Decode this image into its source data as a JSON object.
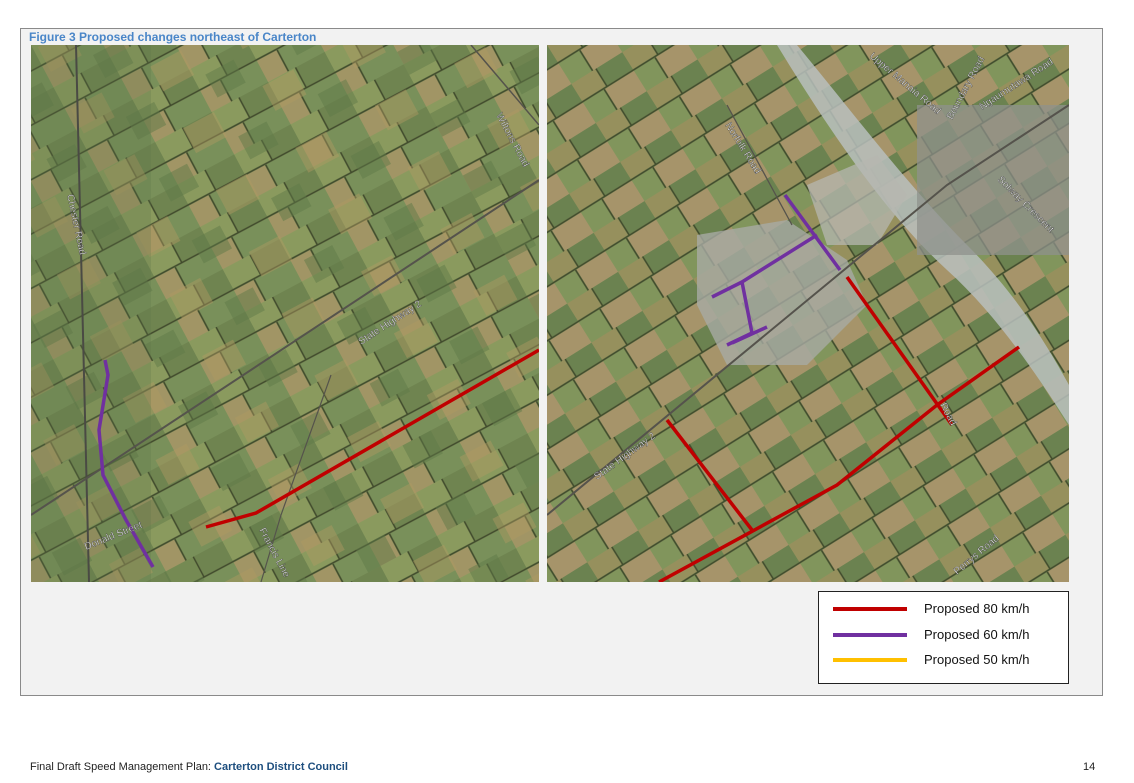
{
  "figure_title": "Figure 3 Proposed changes northeast of Carterton",
  "left_map": {
    "road_labels": [
      "Chester Road",
      "Wiltons Road",
      "State Highway 2",
      "Donald Street",
      "Francis Line"
    ]
  },
  "right_map": {
    "road_labels": [
      "Norfolk Road",
      "Upper Manaia Road",
      "Boundary Road",
      "Ngaumutawa Road",
      "Solway Crescent",
      "State Highway 2",
      "Road",
      "Perrys Road"
    ]
  },
  "legend": {
    "items": [
      {
        "label": "Proposed 80 km/h",
        "color": "#c00000"
      },
      {
        "label": "Proposed 60 km/h",
        "color": "#7030a0"
      },
      {
        "label": "Proposed 50 km/h",
        "color": "#ffc000"
      }
    ]
  },
  "footer": {
    "prefix": "Final Draft Speed Management Plan: ",
    "council": "Carterton District Council",
    "page_number": "14"
  }
}
